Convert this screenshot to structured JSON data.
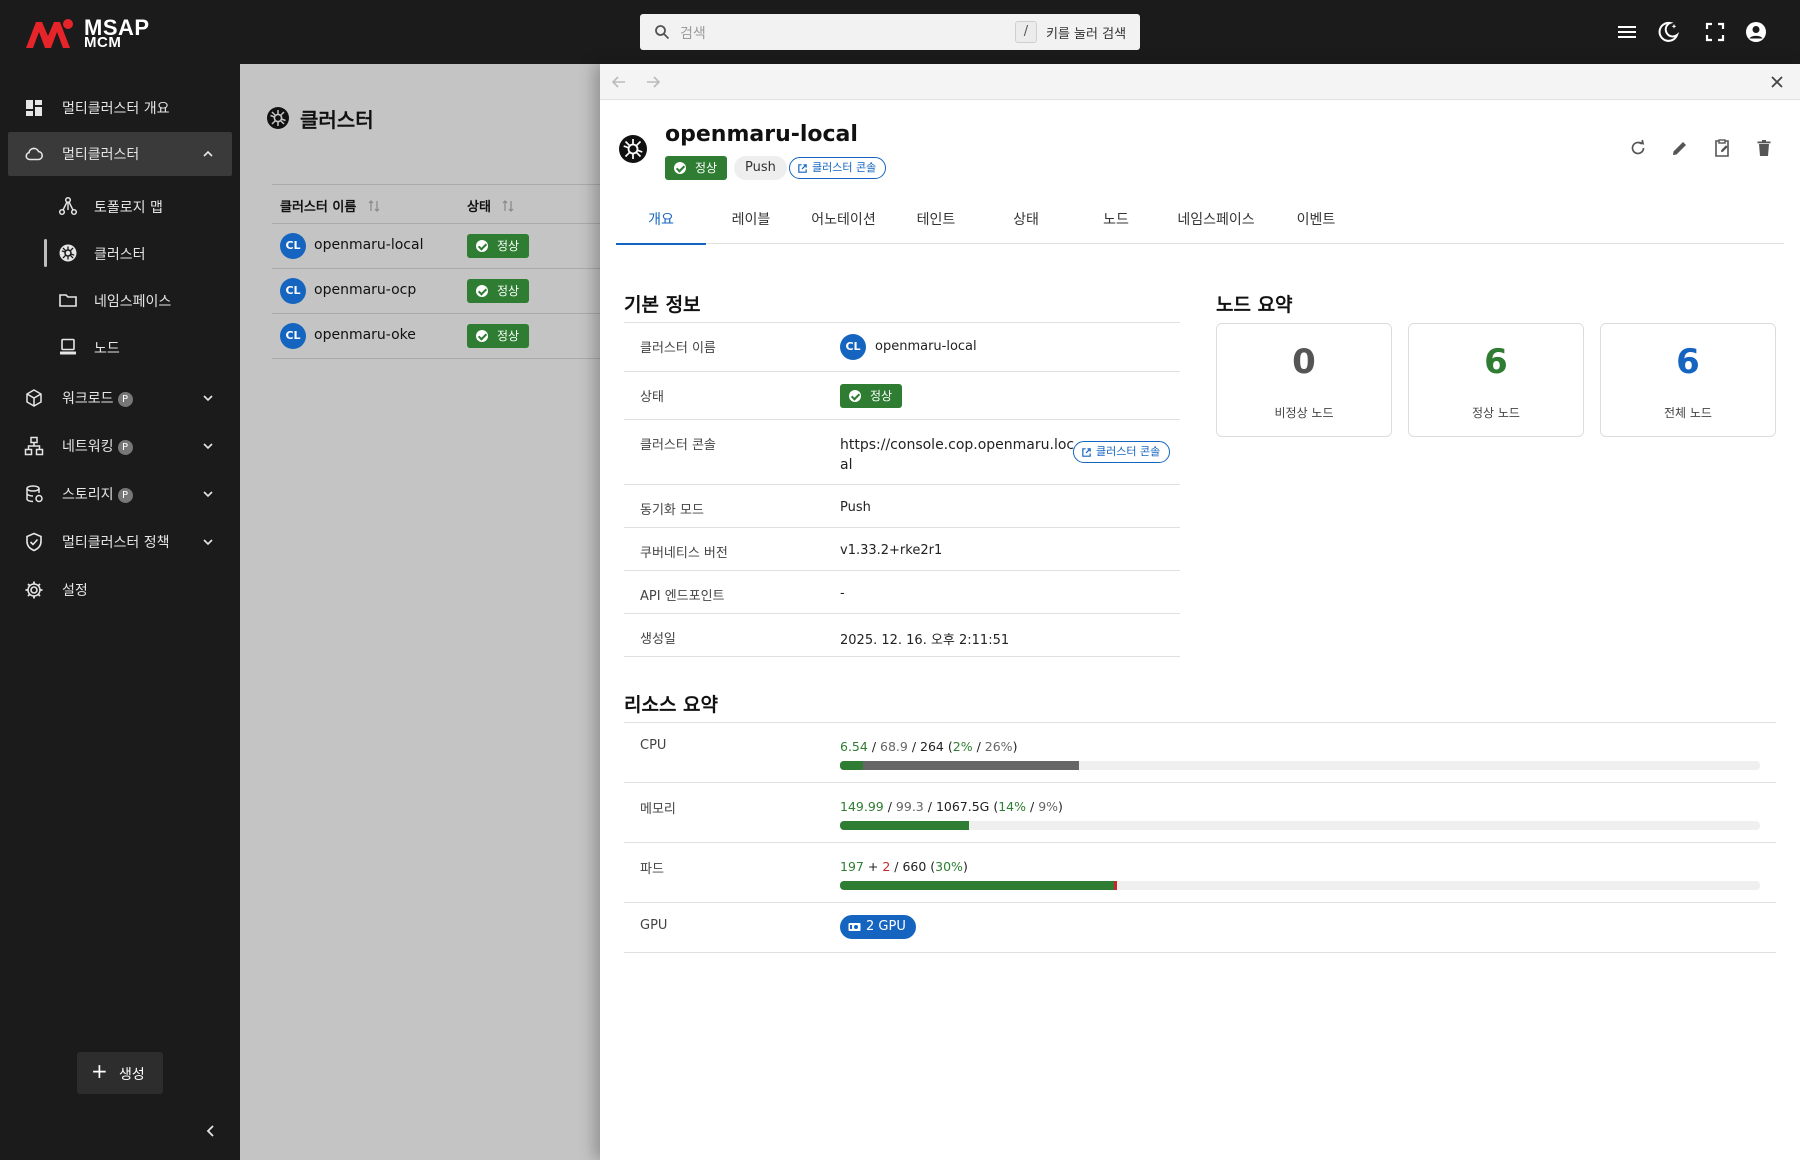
{
  "app": {
    "brand_main": "MSAP",
    "brand_sub": "MCM",
    "brand_color": "#e5252a"
  },
  "search": {
    "placeholder": "검색",
    "shortcut_key": "/",
    "shortcut_hint": "키를 눌러 검색"
  },
  "topbar_icons": [
    "menu-icon",
    "dark-mode-icon",
    "fullscreen-icon",
    "account-icon"
  ],
  "sidebar": {
    "items": [
      {
        "label": "멀티클러스터 개요",
        "icon": "dashboard-icon"
      },
      {
        "label": "멀티클러스터",
        "icon": "cloud-icon",
        "expanded": true
      },
      {
        "label": "워크로드",
        "icon": "cube-icon",
        "badge": "P"
      },
      {
        "label": "네트워킹",
        "icon": "network-icon",
        "badge": "P"
      },
      {
        "label": "스토리지",
        "icon": "storage-icon",
        "badge": "P"
      },
      {
        "label": "멀티클러스터 정책",
        "icon": "shield-icon"
      },
      {
        "label": "설정",
        "icon": "gear-icon"
      }
    ],
    "sub_items": [
      {
        "label": "토폴로지 맵",
        "icon": "topology-icon"
      },
      {
        "label": "클러스터",
        "icon": "kubernetes-icon",
        "active": true
      },
      {
        "label": "네임스페이스",
        "icon": "folder-icon"
      },
      {
        "label": "노드",
        "icon": "node-icon"
      }
    ],
    "create_label": "생성"
  },
  "main": {
    "title": "클러스터",
    "columns": [
      "클러스터 이름",
      "상태"
    ],
    "rows": [
      {
        "avatar": "CL",
        "name": "openmaru-local",
        "status": "정상"
      },
      {
        "avatar": "CL",
        "name": "openmaru-ocp",
        "status": "정상"
      },
      {
        "avatar": "CL",
        "name": "openmaru-oke",
        "status": "정상"
      }
    ]
  },
  "drawer": {
    "title": "openmaru-local",
    "status": "정상",
    "sync_chip": "Push",
    "console_chip": "클러스터 콘솔",
    "tabs": [
      "개요",
      "레이블",
      "어노테이션",
      "테인트",
      "상태",
      "노드",
      "네임스페이스",
      "이벤트"
    ],
    "active_tab": "개요",
    "basic_info_title": "기본 정보",
    "basic_info": {
      "name_key": "클러스터 이름",
      "name_avatar": "CL",
      "name_value": "openmaru-local",
      "status_key": "상태",
      "status_value": "정상",
      "console_key": "클러스터 콘솔",
      "console_url_line1": "https://console.cop.openmaru.loc",
      "console_url_line2": "al",
      "console_button": "클러스터 콘솔",
      "sync_key": "동기화 모드",
      "sync_value": "Push",
      "k8s_key": "쿠버네티스 버전",
      "k8s_value": "v1.33.2+rke2r1",
      "api_key": "API 엔드포인트",
      "api_value": "-",
      "created_key": "생성일",
      "created_value": "2025. 12. 16. 오후 2:11:51"
    },
    "node_summary_title": "노드 요약",
    "node_summary": [
      {
        "value": "0",
        "label": "비정상 노드",
        "color": "#555555"
      },
      {
        "value": "6",
        "label": "정상 노드",
        "color": "#2e7d32"
      },
      {
        "value": "6",
        "label": "전체 노드",
        "color": "#1565c0"
      }
    ],
    "resource_title": "리소스 요약",
    "resources": {
      "cpu": {
        "label": "CPU",
        "used": "6.54",
        "requested": "68.9",
        "total": "264",
        "used_pct": "2%",
        "req_pct": "26%",
        "used_fraction": 0.025,
        "req_fraction": 0.26
      },
      "memory": {
        "label": "메모리",
        "used": "149.99",
        "requested": "99.3",
        "total": "1067.5G",
        "used_pct": "14%",
        "req_pct": "9%",
        "used_fraction": 0.14
      },
      "pods": {
        "label": "파드",
        "running": "197",
        "plus": "+",
        "other": "2",
        "total": "660",
        "pct": "30%",
        "running_fraction": 0.298,
        "other_fraction": 0.003
      },
      "gpu": {
        "label": "GPU",
        "value": "2 GPU"
      }
    }
  }
}
